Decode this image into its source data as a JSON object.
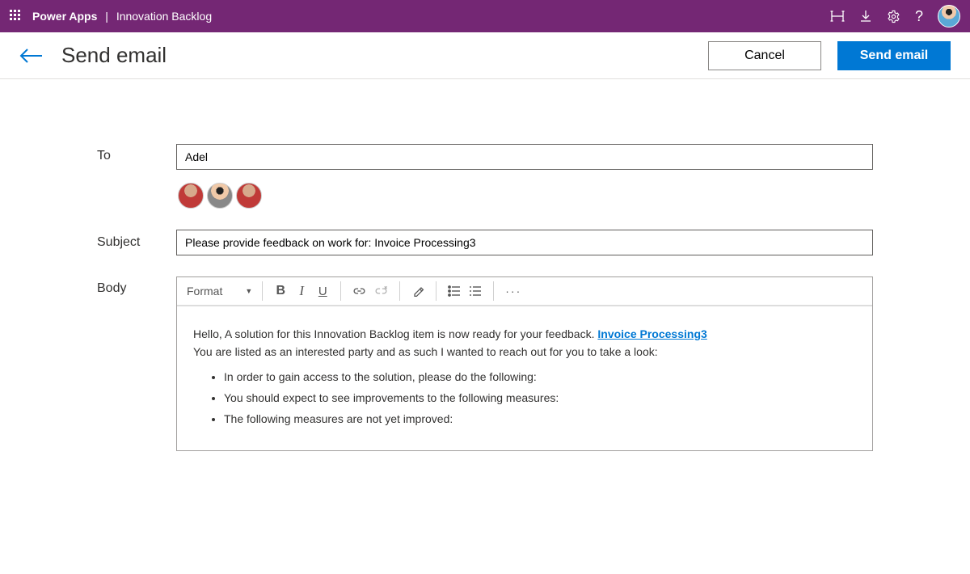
{
  "topbar": {
    "brand": "Power Apps",
    "app": "Innovation Backlog"
  },
  "page": {
    "title": "Send email",
    "cancel_label": "Cancel",
    "send_label": "Send email"
  },
  "form": {
    "to_label": "To",
    "to_value": "Adel",
    "subject_label": "Subject",
    "subject_value": "Please provide feedback on work for: Invoice Processing3",
    "body_label": "Body"
  },
  "editor_toolbar": {
    "format_label": "Format"
  },
  "email": {
    "intro_prefix": "Hello, A solution for this Innovation Backlog item is now ready for your feedback. ",
    "intro_link": "Invoice Processing3",
    "line2": "You are listed as an interested party and as such I wanted to reach out for you to take a look:",
    "bullet1": "In order to gain access to the solution, please do the following:",
    "bullet2": "You should expect to see improvements to the following measures:",
    "bullet3": "The following measures are not yet improved:"
  }
}
